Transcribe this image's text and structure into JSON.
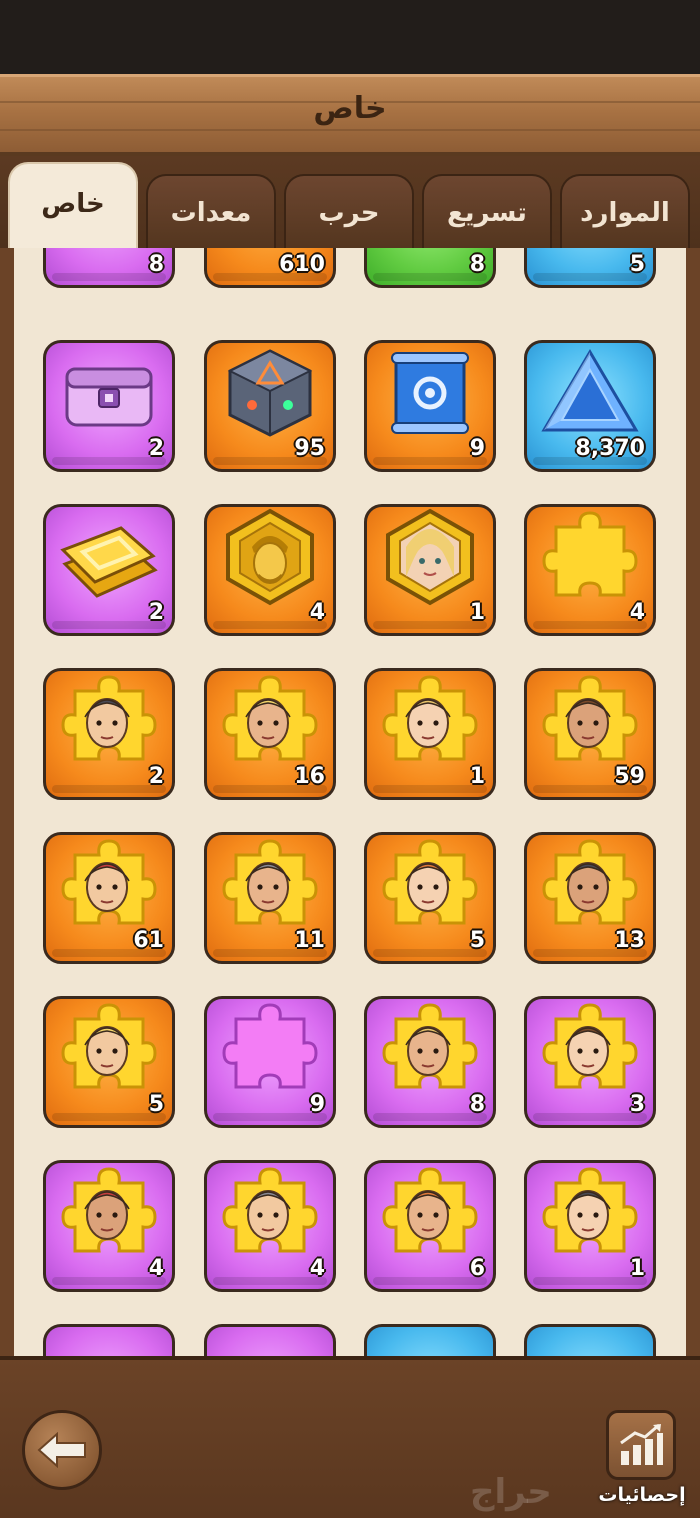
{
  "header": {
    "title": "خاص"
  },
  "tabs": [
    {
      "label": "الموارد"
    },
    {
      "label": "تسريع"
    },
    {
      "label": "حرب"
    },
    {
      "label": "معدات"
    },
    {
      "label": "خاص"
    }
  ],
  "active_tab": "خاص",
  "inventory": {
    "partial_row": [
      {
        "qty": "8",
        "color": "purple",
        "icon": "partial-item-icon"
      },
      {
        "qty": "610",
        "color": "orange",
        "icon": "partial-item-icon"
      },
      {
        "qty": "8",
        "color": "green",
        "icon": "partial-item-icon"
      },
      {
        "qty": "5",
        "color": "blue",
        "icon": "partial-item-icon"
      }
    ],
    "rows": [
      [
        {
          "qty": "2",
          "color": "purple",
          "icon": "chest-icon"
        },
        {
          "qty": "95",
          "color": "orange",
          "icon": "cube-icon"
        },
        {
          "qty": "9",
          "color": "orange",
          "icon": "blueprint-scroll-icon"
        },
        {
          "qty": "8,370",
          "color": "blue",
          "icon": "crystal-triangle-icon"
        }
      ],
      [
        {
          "qty": "2",
          "color": "purple",
          "icon": "gold-bars-icon"
        },
        {
          "qty": "4",
          "color": "orange",
          "icon": "hero-medal-male-icon"
        },
        {
          "qty": "1",
          "color": "orange",
          "icon": "hero-medal-female-icon"
        },
        {
          "qty": "4",
          "color": "orange",
          "icon": "golden-puzzle-icon"
        }
      ],
      [
        {
          "qty": "2",
          "color": "orange",
          "icon": "hero-puzzle-icon"
        },
        {
          "qty": "16",
          "color": "orange",
          "icon": "hero-puzzle-icon"
        },
        {
          "qty": "1",
          "color": "orange",
          "icon": "hero-puzzle-icon"
        },
        {
          "qty": "59",
          "color": "orange",
          "icon": "hero-puzzle-icon"
        }
      ],
      [
        {
          "qty": "61",
          "color": "orange",
          "icon": "hero-puzzle-icon"
        },
        {
          "qty": "11",
          "color": "orange",
          "icon": "hero-puzzle-icon"
        },
        {
          "qty": "5",
          "color": "orange",
          "icon": "hero-puzzle-icon"
        },
        {
          "qty": "13",
          "color": "orange",
          "icon": "hero-puzzle-icon"
        }
      ],
      [
        {
          "qty": "5",
          "color": "orange",
          "icon": "hero-puzzle-icon"
        },
        {
          "qty": "9",
          "color": "purple",
          "icon": "pink-puzzle-icon"
        },
        {
          "qty": "8",
          "color": "purple",
          "icon": "hero-puzzle-icon"
        },
        {
          "qty": "3",
          "color": "purple",
          "icon": "hero-puzzle-icon"
        }
      ],
      [
        {
          "qty": "4",
          "color": "purple",
          "icon": "hero-puzzle-icon"
        },
        {
          "qty": "4",
          "color": "purple",
          "icon": "hero-puzzle-icon"
        },
        {
          "qty": "6",
          "color": "purple",
          "icon": "hero-puzzle-icon"
        },
        {
          "qty": "1",
          "color": "purple",
          "icon": "hero-puzzle-icon"
        }
      ]
    ],
    "bottom_partial_row": [
      {
        "color": "purple"
      },
      {
        "color": "purple"
      },
      {
        "color": "blue"
      },
      {
        "color": "blue"
      }
    ]
  },
  "footer": {
    "stats_label": "إحصائيات",
    "watermark": "حراج"
  },
  "colors": {
    "orange": "#f68a1c",
    "purple": "#d96cf0",
    "blue": "#48b9ee",
    "green": "#62cc42",
    "wood": "#6b4327",
    "panel": "#f1e6d3"
  }
}
